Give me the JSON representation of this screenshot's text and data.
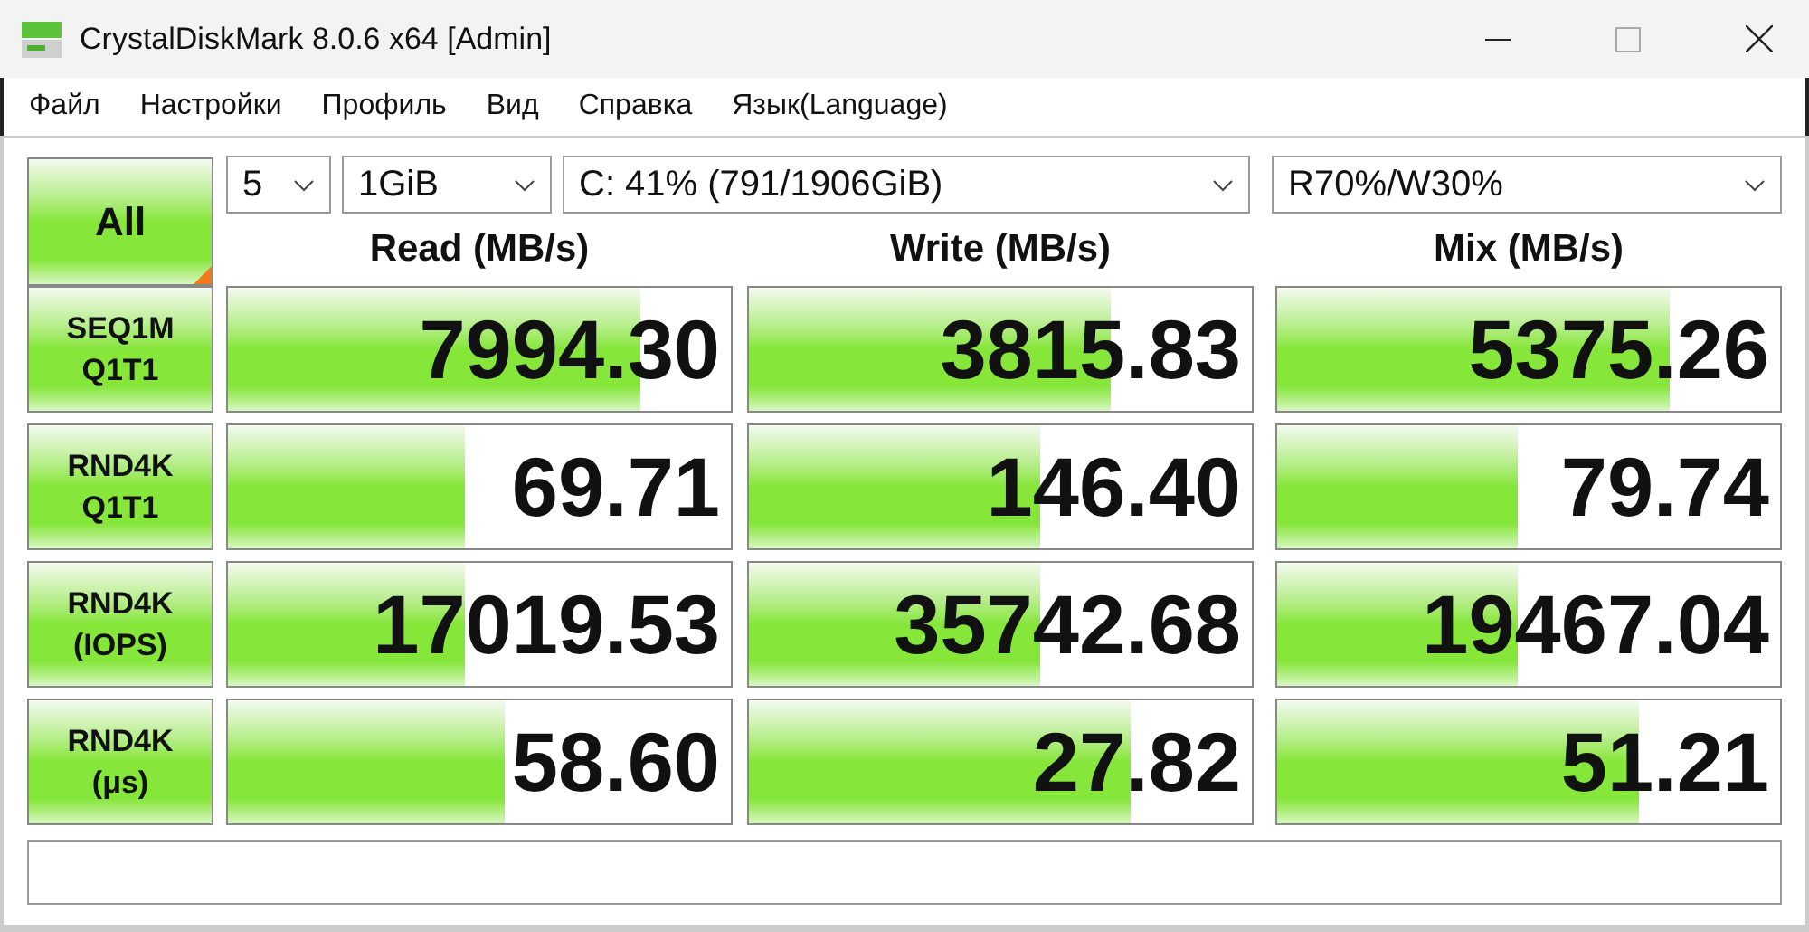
{
  "window": {
    "title": "CrystalDiskMark 8.0.6 x64 [Admin]"
  },
  "menu": [
    "Файл",
    "Настройки",
    "Профиль",
    "Вид",
    "Справка",
    "Язык(Language)"
  ],
  "all_button": "All",
  "selects": [
    {
      "kind": "count",
      "value": "5"
    },
    {
      "kind": "size",
      "value": "1GiB"
    },
    {
      "kind": "drive",
      "value": "C: 41% (791/1906GiB)"
    },
    {
      "kind": "mix",
      "value": "R70%/W30%"
    }
  ],
  "columns": [
    "Read (MB/s)",
    "Write (MB/s)",
    "Mix (MB/s)"
  ],
  "rows": [
    {
      "label": [
        "SEQ1M",
        "Q1T1"
      ],
      "cells": [
        {
          "value": "7994.30",
          "level": 0.82
        },
        {
          "value": "3815.83",
          "level": 0.72
        },
        {
          "value": "5375.26",
          "level": 0.78
        }
      ]
    },
    {
      "label": [
        "RND4K",
        "Q1T1"
      ],
      "cells": [
        {
          "value": "69.71",
          "level": 0.47
        },
        {
          "value": "146.40",
          "level": 0.58
        },
        {
          "value": "79.74",
          "level": 0.48
        }
      ]
    },
    {
      "label": [
        "RND4K",
        "(IOPS)"
      ],
      "cells": [
        {
          "value": "17019.53",
          "level": 0.47
        },
        {
          "value": "35742.68",
          "level": 0.58
        },
        {
          "value": "19467.04",
          "level": 0.48
        }
      ]
    },
    {
      "label": [
        "RND4K",
        "(μs)"
      ],
      "cells": [
        {
          "value": "58.60",
          "level": 0.55
        },
        {
          "value": "27.82",
          "level": 0.76
        },
        {
          "value": "51.21",
          "level": 0.72
        }
      ]
    }
  ]
}
